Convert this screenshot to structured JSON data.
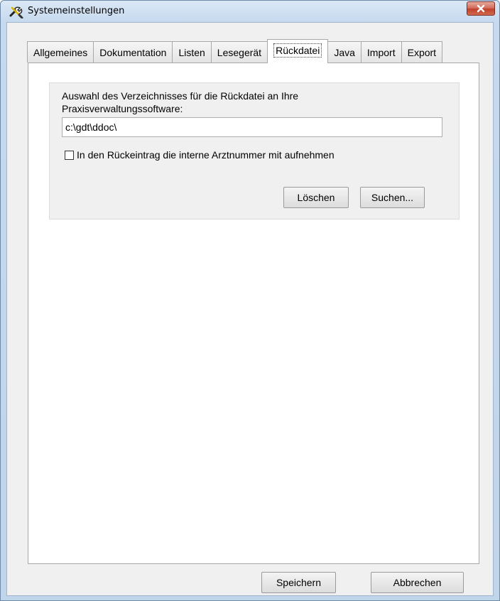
{
  "window": {
    "title": "Systemeinstellungen"
  },
  "tabs": [
    {
      "label": "Allgemeines"
    },
    {
      "label": "Dokumentation"
    },
    {
      "label": "Listen"
    },
    {
      "label": "Lesegerät"
    },
    {
      "label": "Rückdatei",
      "active": true
    },
    {
      "label": "Java"
    },
    {
      "label": "Import"
    },
    {
      "label": "Export"
    }
  ],
  "rueckdatei": {
    "description": "Auswahl des Verzeichnisses für die Rückdatei an Ihre Praxisverwaltungssoftware:",
    "path_value": "c:\\gdt\\ddoc\\",
    "checkbox_label": "In den Rückeintrag die interne Arztnummer mit aufnehmen",
    "checkbox_checked": false,
    "delete_label": "Löschen",
    "browse_label": "Suchen..."
  },
  "footer": {
    "save_label": "Speichern",
    "cancel_label": "Abbrechen"
  },
  "icons": {
    "app": "wrench-screwdriver-icon",
    "close": "close-icon"
  },
  "colors": {
    "close_button": "#c0412b",
    "titlebar": "#c6d9ee"
  }
}
